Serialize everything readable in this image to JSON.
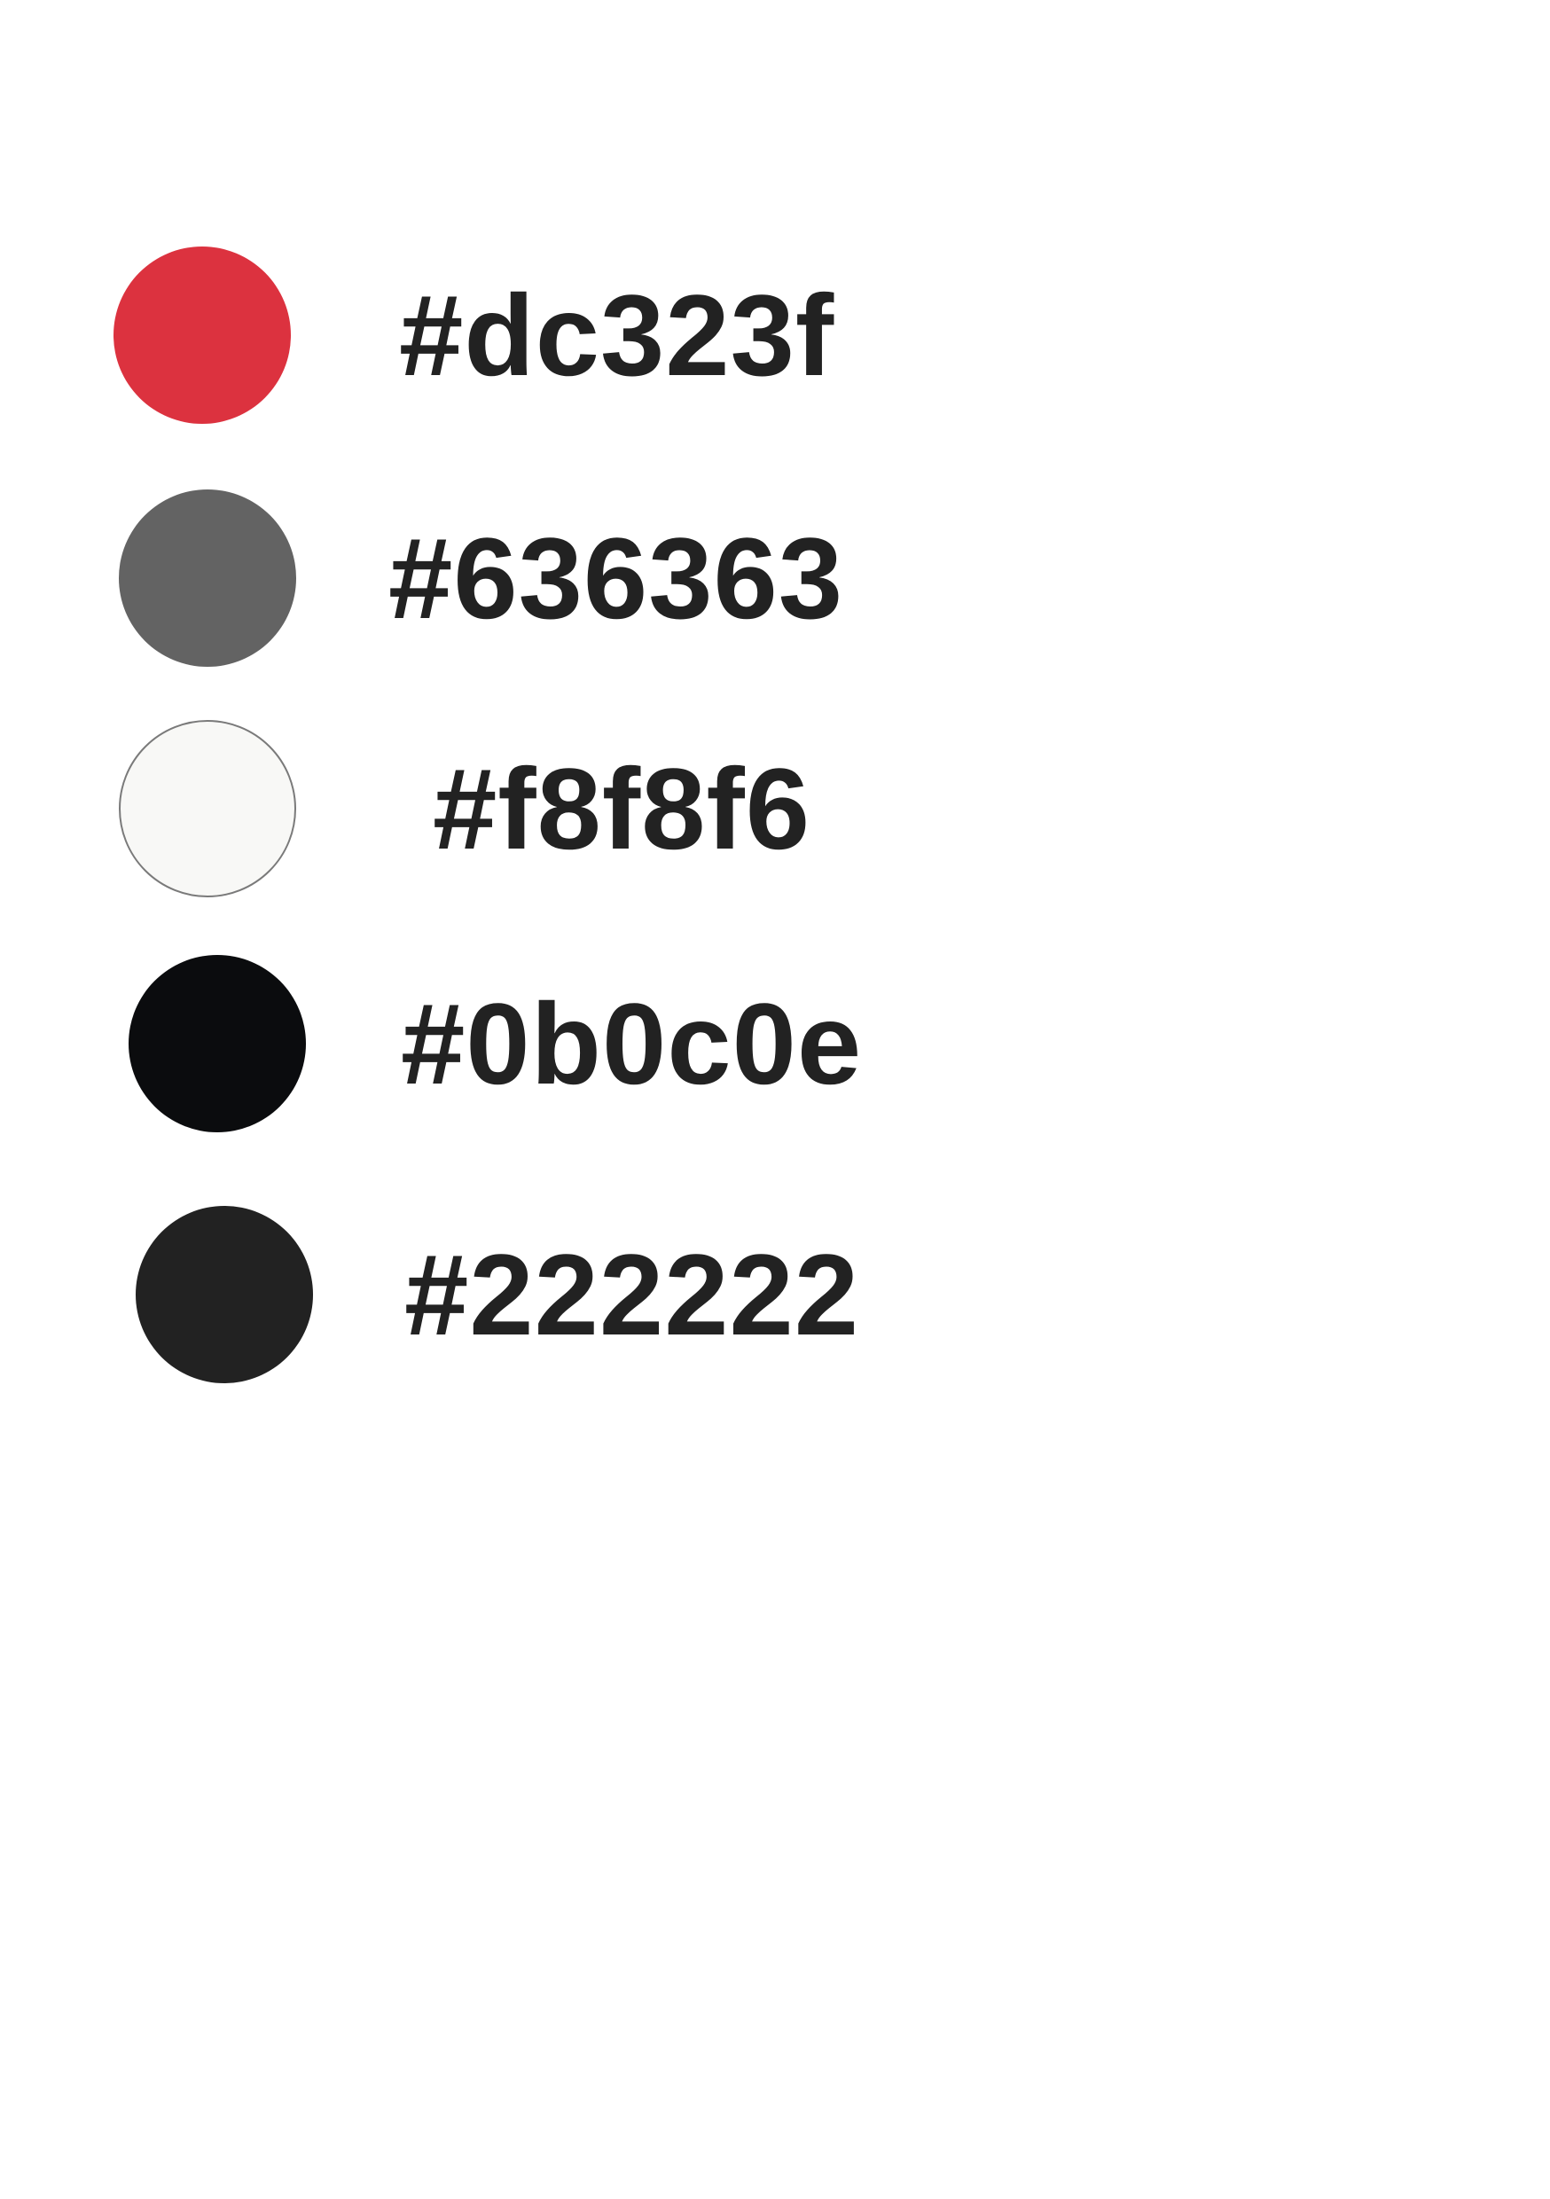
{
  "swatches": [
    {
      "label": "#dc323f",
      "color": "#dc323f"
    },
    {
      "label": "#636363",
      "color": "#636363"
    },
    {
      "label": "#f8f8f6",
      "color": "#f8f8f6"
    },
    {
      "label": "#0b0c0e",
      "color": "#0b0c0e"
    },
    {
      "label": "#222222",
      "color": "#222222"
    }
  ],
  "text_color": "#222222",
  "background": "#ffffff"
}
